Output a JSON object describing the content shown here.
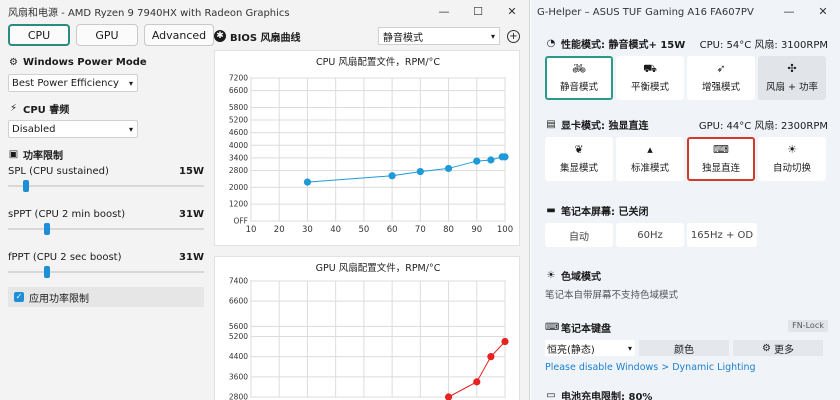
{
  "left": {
    "title": "风扇和电源 - AMD Ryzen 9 7940HX with Radeon Graphics",
    "controls": {
      "minimize": "—",
      "maximize": "☐",
      "close": "✕"
    },
    "tabs": [
      "CPU",
      "GPU",
      "Advanced"
    ],
    "windows_power_mode": {
      "label": "Windows Power Mode",
      "value": "Best Power Efficiency"
    },
    "cpu_boost": {
      "label": "CPU 睿频",
      "value": "Disabled"
    },
    "power_limit": {
      "label": "功率限制",
      "spl": {
        "label": "SPL (CPU sustained)",
        "value": "15W",
        "fraction": 0.08
      },
      "sppt": {
        "label": "sPPT (CPU 2 min boost)",
        "value": "31W",
        "fraction": 0.19
      },
      "fppt": {
        "label": "fPPT (CPU 2 sec boost)",
        "value": "31W",
        "fraction": 0.19
      },
      "apply_label": "应用功率限制"
    },
    "bios": {
      "label": "BIOS 风扇曲线",
      "profile": "静音模式"
    }
  },
  "chart_data": [
    {
      "type": "line",
      "title": "CPU 风扇配置文件，RPM/°C",
      "color": "#1e9ad8",
      "x": [
        30,
        60,
        70,
        80,
        90,
        95,
        99,
        100
      ],
      "y": [
        2250,
        2550,
        2750,
        2900,
        3250,
        3300,
        3450,
        3450
      ],
      "xticks": [
        10,
        20,
        30,
        40,
        50,
        60,
        70,
        80,
        90,
        100
      ],
      "yticks": [
        400,
        1200,
        2000,
        2800,
        3400,
        4000,
        4600,
        5200,
        5800,
        6600,
        7200
      ],
      "ytick_labels": [
        "OFF",
        "1200",
        "2000",
        "2800",
        "3400",
        "4000",
        "4600",
        "5200",
        "5800",
        "6600",
        "7200"
      ],
      "xlim": [
        10,
        100
      ],
      "ylim": [
        400,
        7200
      ],
      "grid": true
    },
    {
      "type": "line",
      "title": "GPU 风扇配置文件，RPM/°C",
      "color": "#e62222",
      "x": [
        80,
        90,
        95,
        100
      ],
      "y": [
        2800,
        3400,
        4400,
        5000
      ],
      "yticks": [
        2800,
        3600,
        4400,
        5200,
        5600,
        6600,
        7400
      ],
      "ylim": [
        2800,
        7400
      ],
      "xlim": [
        10,
        100
      ],
      "grid": true
    }
  ],
  "right": {
    "title": "G-Helper – ASUS TUF Gaming A16 FA607PV",
    "controls": {
      "minimize": "—",
      "close": "✕"
    },
    "perf": {
      "label": "性能模式: 静音模式+ 15W",
      "status": "CPU: 54°C 风扇: 3100RPM",
      "modes": [
        "静音模式",
        "平衡模式",
        "增强模式",
        "风扇 + 功率"
      ]
    },
    "gpu": {
      "label": "显卡模式: 独显直连",
      "status": "GPU: 44°C 风扇: 2300RPM",
      "modes": [
        "集显模式",
        "标准模式",
        "独显直连",
        "自动切换"
      ]
    },
    "screen": {
      "label": "笔记本屏幕: 已关闭",
      "buttons": [
        "自动",
        "60Hz",
        "165Hz + OD"
      ]
    },
    "color": {
      "label": "色域模式",
      "desc": "笔记本自带屏幕不支持色域模式"
    },
    "keyboard": {
      "label": "笔记本键盘",
      "fnlock": "FN-Lock",
      "mode": "恒亮(静态)",
      "color_btn": "颜色",
      "more_btn": "更多",
      "link": "Please disable Windows > Dynamic Lighting"
    },
    "battery": {
      "label": "电池充电限制: 80%"
    }
  }
}
